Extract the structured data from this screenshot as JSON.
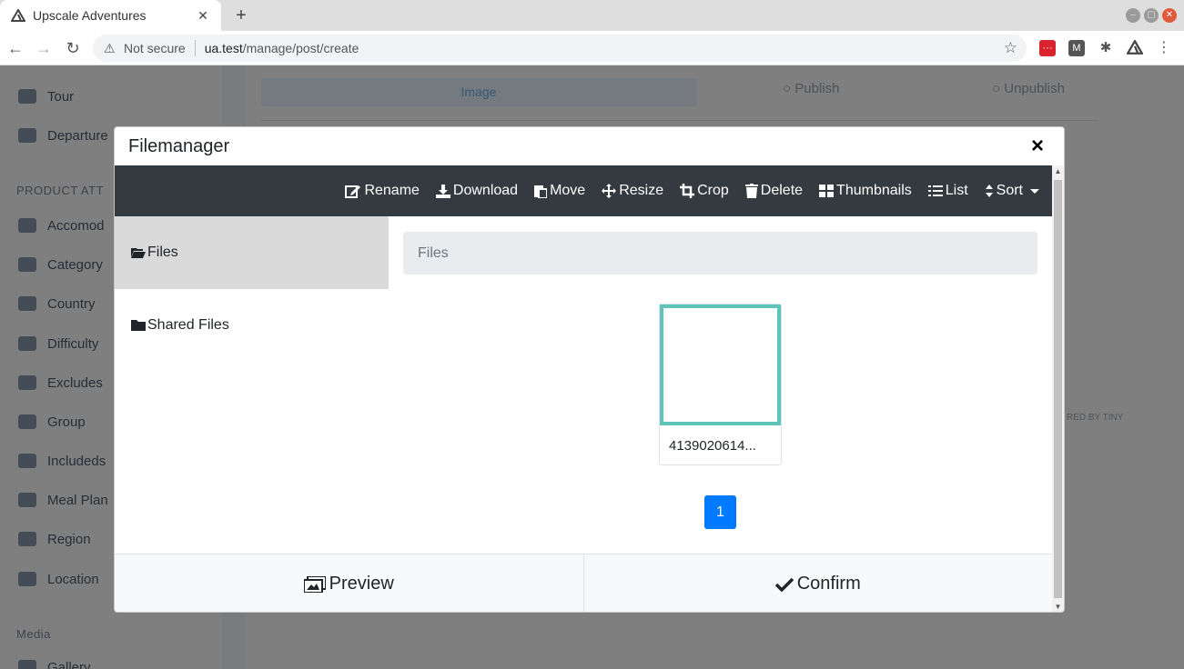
{
  "browser": {
    "tab_title": "Upscale Adventures",
    "tab_close": "✕",
    "new_tab": "+",
    "security_label": "Not secure",
    "url_host": "ua.test",
    "url_path": "/manage/post/create"
  },
  "background": {
    "sidebar_items": [
      "Tour",
      "Departure"
    ],
    "sidebar_heading": "PRODUCT ATT",
    "sidebar_items2": [
      "Accomod",
      "Category",
      "Country",
      "Difficulty",
      "Excludes",
      "Group",
      "Includeds",
      "Meal Plan",
      "Region",
      "Location"
    ],
    "sidebar_heading2": "Media",
    "sidebar_items3": [
      "Gallery"
    ],
    "image_button": "Image",
    "publish": "Publish",
    "unpublish": "Unpublish",
    "small_text": "RED BY TINY"
  },
  "modal": {
    "title": "Filemanager",
    "close": "×"
  },
  "toolbar": {
    "rename": "Rename",
    "download": "Download",
    "move": "Move",
    "resize": "Resize",
    "crop": "Crop",
    "delete": "Delete",
    "thumbnails": "Thumbnails",
    "list": "List",
    "sort": "Sort"
  },
  "tree": {
    "files": "Files",
    "shared_files": "Shared Files"
  },
  "breadcrumb": "Files",
  "files": [
    {
      "name": "4139020614..."
    }
  ],
  "pagination": {
    "current": "1"
  },
  "footer": {
    "preview": "Preview",
    "confirm": "Confirm"
  }
}
